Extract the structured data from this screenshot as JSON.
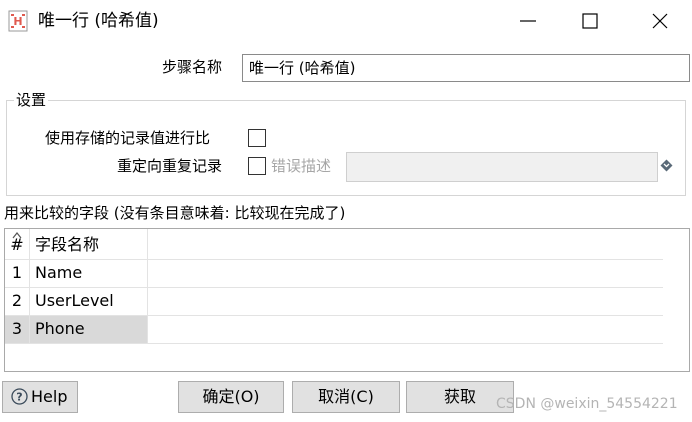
{
  "window": {
    "title": "唯一行 (哈希值)",
    "icon": "unique-rows-app-icon",
    "accent_color": "#e05a4f"
  },
  "form": {
    "step_name_label": "步骤名称",
    "step_name_value": "唯一行 (哈希值)",
    "settings_legend": "设置",
    "use_stored_label": "使用存储的记录值进行比",
    "use_stored_checked": false,
    "redirect_label": "重定向重复记录",
    "redirect_checked": false,
    "error_desc_label": "错误描述",
    "error_desc_value": ""
  },
  "fields": {
    "caption": "用来比较的字段 (没有条目意味着: 比较现在完成了)",
    "columns": [
      "#",
      "字段名称"
    ],
    "rows": [
      {
        "num": "1",
        "name": "Name"
      },
      {
        "num": "2",
        "name": "UserLevel"
      },
      {
        "num": "3",
        "name": "Phone"
      }
    ],
    "selected_row": 3
  },
  "buttons": {
    "help": "Help",
    "ok": "确定(O)",
    "cancel": "取消(C)",
    "get": "获取"
  },
  "watermark": "CSDN @weixin_54554221"
}
